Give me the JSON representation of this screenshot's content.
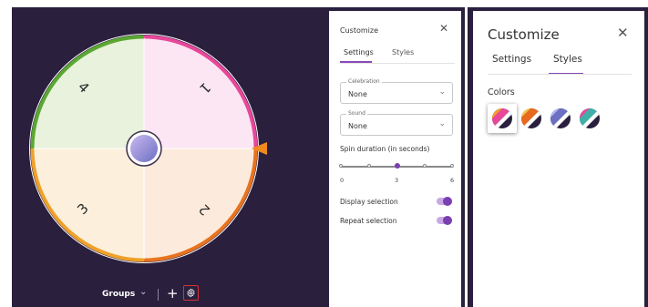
{
  "wheel": {
    "segments": [
      {
        "label": "1",
        "fill": "#fce6f3",
        "rim": "#e8479a"
      },
      {
        "label": "2",
        "fill": "#fcebdc",
        "rim": "#e8731f"
      },
      {
        "label": "3",
        "fill": "#fcf0dc",
        "rim": "#f0a12a"
      },
      {
        "label": "4",
        "fill": "#e9f2dc",
        "rim": "#5aa832"
      }
    ],
    "pointer_color": "#f08a1e",
    "hub_color": "#6c6fc2"
  },
  "bottom_bar": {
    "groups_label": "Groups",
    "chevron_glyph": "⌄",
    "add_glyph": "+",
    "settings_icon": "gear-icon"
  },
  "panel_small": {
    "title": "Customize",
    "close_glyph": "✕",
    "tabs": [
      "Settings",
      "Styles"
    ],
    "active_tab": "Settings",
    "celebration": {
      "label": "Celebration",
      "value": "None"
    },
    "sound": {
      "label": "Sound",
      "value": "None"
    },
    "select_chevron": "⌄",
    "spin_duration": {
      "label": "Spin duration (in seconds)",
      "ticks": [
        "0",
        "3",
        "6"
      ],
      "value": 3
    },
    "display_selection": {
      "label": "Display selection",
      "on": true
    },
    "repeat_selection": {
      "label": "Repeat selection",
      "on": true
    }
  },
  "panel_large": {
    "title": "Customize",
    "close_glyph": "✕",
    "tabs": [
      "Settings",
      "Styles"
    ],
    "active_tab": "Styles",
    "colors_label": "Colors",
    "swatches": [
      {
        "name": "rainbow-dark",
        "selected": true
      },
      {
        "name": "warm-dark",
        "selected": false
      },
      {
        "name": "cool-dark",
        "selected": false
      },
      {
        "name": "multi-dark",
        "selected": false
      }
    ],
    "accent": "#8a49b8"
  }
}
